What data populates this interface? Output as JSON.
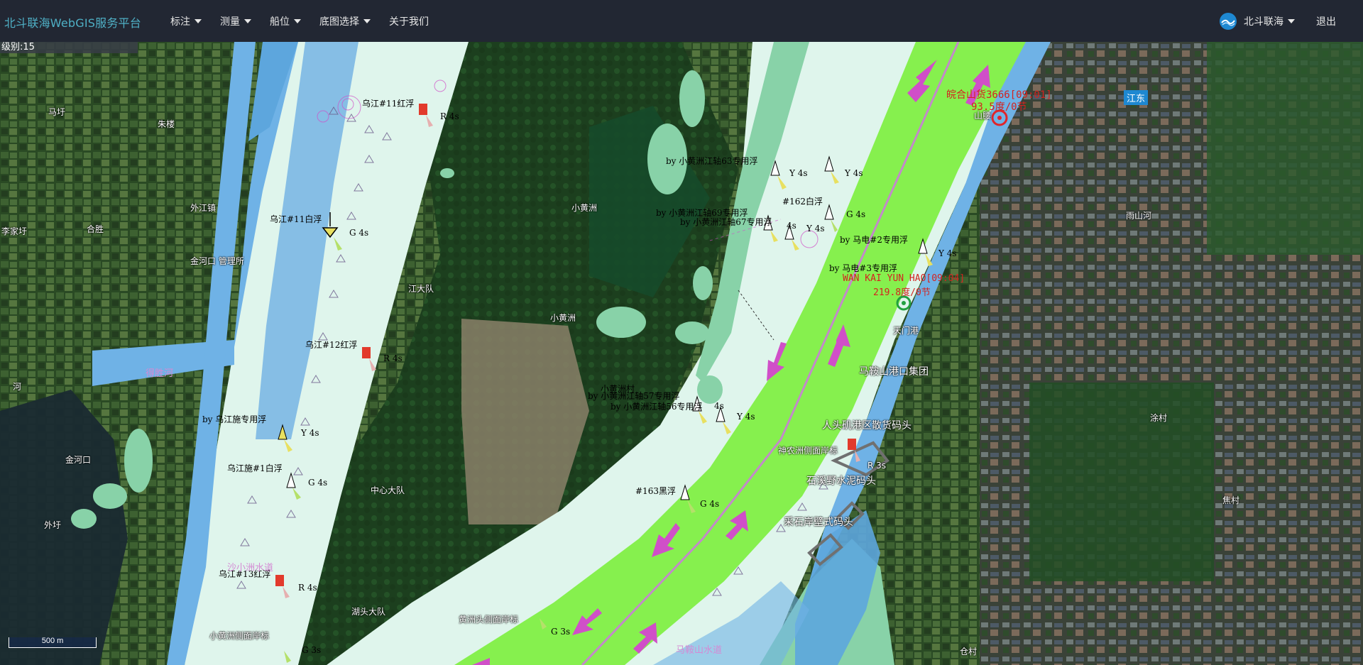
{
  "nav": {
    "brand": "北斗联海WebGIS服务平台",
    "menu": [
      {
        "label": "标注"
      },
      {
        "label": "测量"
      },
      {
        "label": "船位"
      },
      {
        "label": "底图选择"
      },
      {
        "label": "关于我们"
      }
    ],
    "user": "北斗联海",
    "logout": "退出"
  },
  "map": {
    "level": "级别:15",
    "scale": "500 m",
    "ships": [
      {
        "name": "皖合山货3666[09:01]",
        "course": "93.5度/0节",
        "color": "#d3231f"
      },
      {
        "name": "WAN KAI YUN HAO[09:04]",
        "course": "219.8度/0节",
        "color": "#2e9a3c"
      }
    ],
    "buoys": [
      {
        "name": "乌江#11红浮",
        "light": "R 4s"
      },
      {
        "name": "乌江#11白浮",
        "light": "G 4s"
      },
      {
        "name": "乌江#12红浮",
        "light": "R 4s"
      },
      {
        "name": "by 乌江施专用浮",
        "light": "Y 4s"
      },
      {
        "name": "乌江施#1白浮",
        "light": "G 4s"
      },
      {
        "name": "乌江#13红浮",
        "light": "R 4s"
      },
      {
        "name": "by 小黄洲江轴63专用浮",
        "light": "Y 4s"
      },
      {
        "name": "by 小黄洲江轴69专用浮",
        "light": "Y 4s"
      },
      {
        "name": "by 小黄洲江轴67专用浮",
        "light": "4s"
      },
      {
        "name": "#162白浮",
        "light": "G 4s"
      },
      {
        "name": "by 马电#2专用浮",
        "light": "Y 4s"
      },
      {
        "name": "by 马电#3专用浮",
        "light": "Y 4s"
      },
      {
        "name": "小黄洲村",
        "light": ""
      },
      {
        "name": "by 小黄洲江轴57专用浮",
        "light": "4s"
      },
      {
        "name": "by 小黄洲江轴56专用浮",
        "light": "Y 4s"
      },
      {
        "name": "#163黑浮",
        "light": "G 4s"
      },
      {
        "name": "神农洲侧面岸标",
        "light": "R 3s"
      },
      {
        "name": "黄洲头侧面岸标",
        "light": "G 3s"
      },
      {
        "name": "小黄洲侧面岸标",
        "light": "G 3s"
      }
    ],
    "places": {
      "xiaohuangzhou": "小黄洲",
      "xiaohuangzhou2": "小黄洲",
      "wujiang_dadui": "江大队",
      "zhongxin_dadui": "中心大队",
      "hutou_dadui": "湖头大队",
      "maanshan_port": "马鞍山港口集团",
      "rentouji": "人头矶港区散货码头",
      "shixi": "石溪野水泥码头",
      "caishi": "采石岸壁式码头",
      "tianmen": "天门港",
      "maanshan_waterway": "马鞍山水道",
      "shaozhou_waterway": "沙小洲水道",
      "dehe": "得胜河",
      "he": "河",
      "jinhekou": "金河口",
      "waibian": "外圩",
      "wujiangzhen": "外江镇",
      "hubian": "李家圩",
      "hesheng": "合胜",
      "jinkou_mgmt": "金河口\n管理所",
      "mahui": "马圩",
      "zhuyi": "朱楼",
      "jiangdong": "江东",
      "cuncun": "涂村",
      "xiangshan": "雨山河",
      "shanyu": "山腰",
      "jiaoxiu": "焦村",
      "cangxiu": "仓村"
    }
  }
}
